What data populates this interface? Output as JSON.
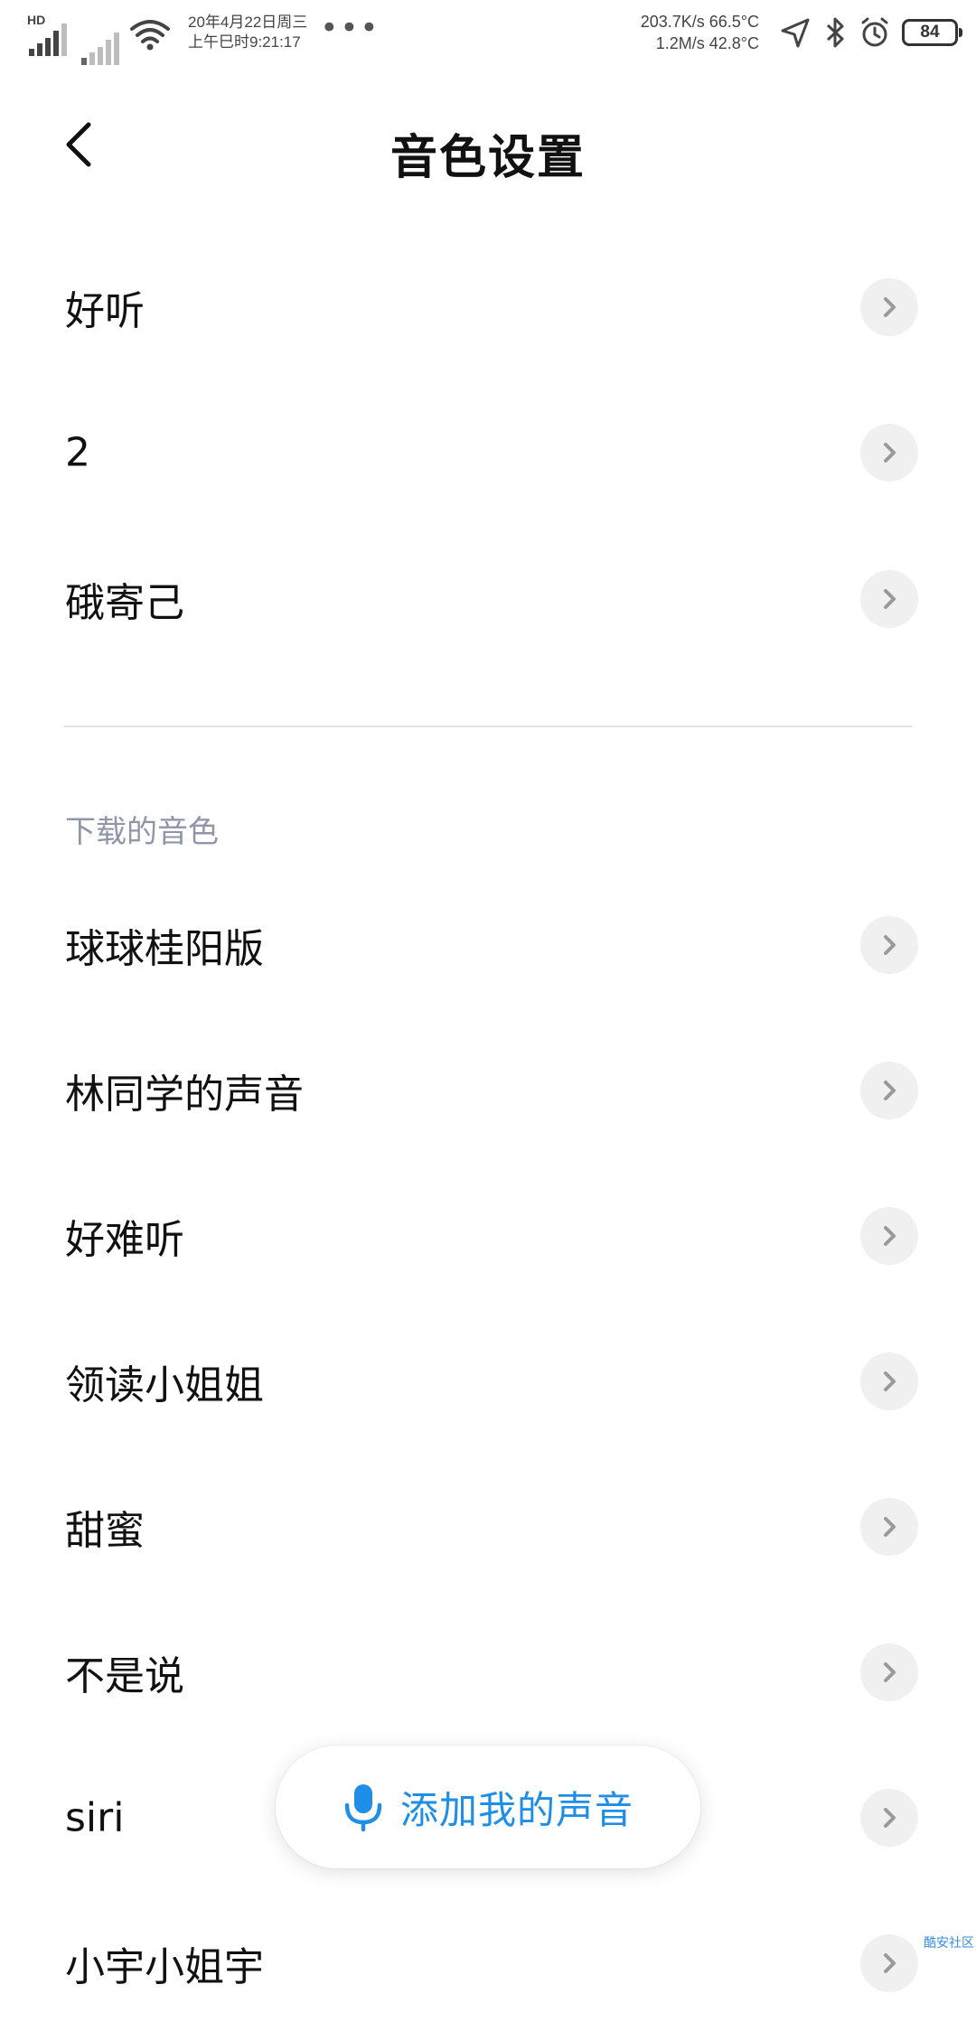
{
  "status_bar": {
    "hd_label": "HD",
    "date_line1": "20年4月22日周三",
    "date_line2": "上午巳时9:21:17",
    "more_dots": "•••",
    "speed_line1": "203.7K/s 66.5°C",
    "speed_line2": "1.2M/s 42.8°C",
    "battery_level": "84"
  },
  "header": {
    "title": "音色设置"
  },
  "list": {
    "custom_voices": [
      {
        "label": "好听"
      },
      {
        "label": "2"
      },
      {
        "label": "硪寄己"
      }
    ],
    "downloaded_section_title": "下载的音色",
    "downloaded_voices": [
      {
        "label": "球球桂阳版"
      },
      {
        "label": "林同学的声音"
      },
      {
        "label": "好难听"
      },
      {
        "label": "领读小姐姐"
      },
      {
        "label": "甜蜜"
      },
      {
        "label": "不是说"
      },
      {
        "label": "siri"
      },
      {
        "label": "小宇小姐宇"
      }
    ]
  },
  "add_voice_button": {
    "label": "添加我的声音"
  },
  "watermark": "酷安社区",
  "colors": {
    "accent": "#1e8ee6",
    "section_label": "#8e96a8",
    "chevron_bg": "#f0f0f0",
    "chevron": "#9a9a9a"
  }
}
